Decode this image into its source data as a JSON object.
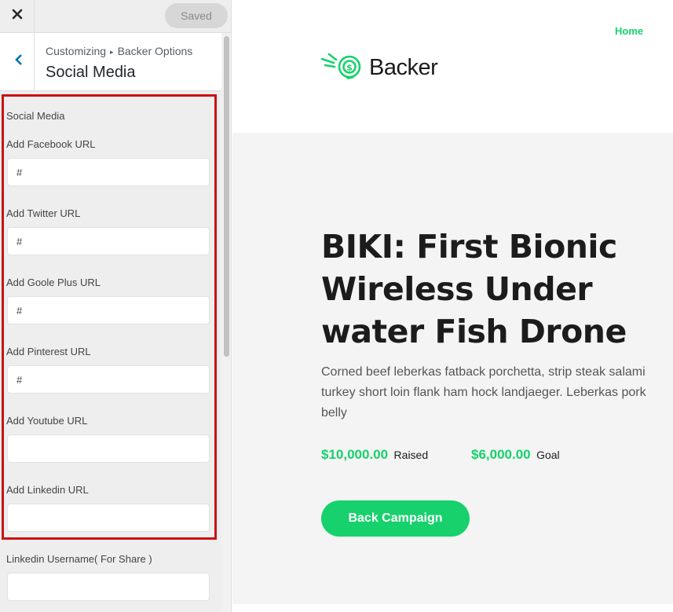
{
  "topbar": {
    "close_icon": "close-icon",
    "saved_label": "Saved"
  },
  "section": {
    "breadcrumb_root": "Customizing",
    "breadcrumb_separator": "▸",
    "breadcrumb_parent": "Backer Options",
    "title": "Social Media"
  },
  "controls": {
    "group_label": "Social Media",
    "fields": [
      {
        "label": "Add Facebook URL",
        "value": "#"
      },
      {
        "label": "Add Twitter URL",
        "value": "#"
      },
      {
        "label": "Add Goole Plus URL",
        "value": "#"
      },
      {
        "label": "Add Pinterest URL",
        "value": "#"
      },
      {
        "label": "Add Youtube URL",
        "value": ""
      },
      {
        "label": "Add Linkedin URL",
        "value": ""
      },
      {
        "label": "Linkedin Username( For Share )",
        "value": ""
      }
    ],
    "highlight_color": "#cc1010"
  },
  "preview": {
    "nav": {
      "home": "Home"
    },
    "logo": {
      "text": "Backer",
      "icon": "rocket-coin-icon"
    },
    "hero": {
      "title": "BIKI: First Bionic Wireless Under water Fish Drone",
      "description": "Corned beef leberkas fatback porchetta, strip steak salami turkey short loin flank ham hock landjaeger. Leberkas pork belly",
      "raised_amount": "$10,000.00",
      "raised_label": "Raised",
      "goal_amount": "$6,000.00",
      "goal_label": "Goal",
      "cta_label": "Back Campaign"
    },
    "accent_color": "#17d16c"
  }
}
